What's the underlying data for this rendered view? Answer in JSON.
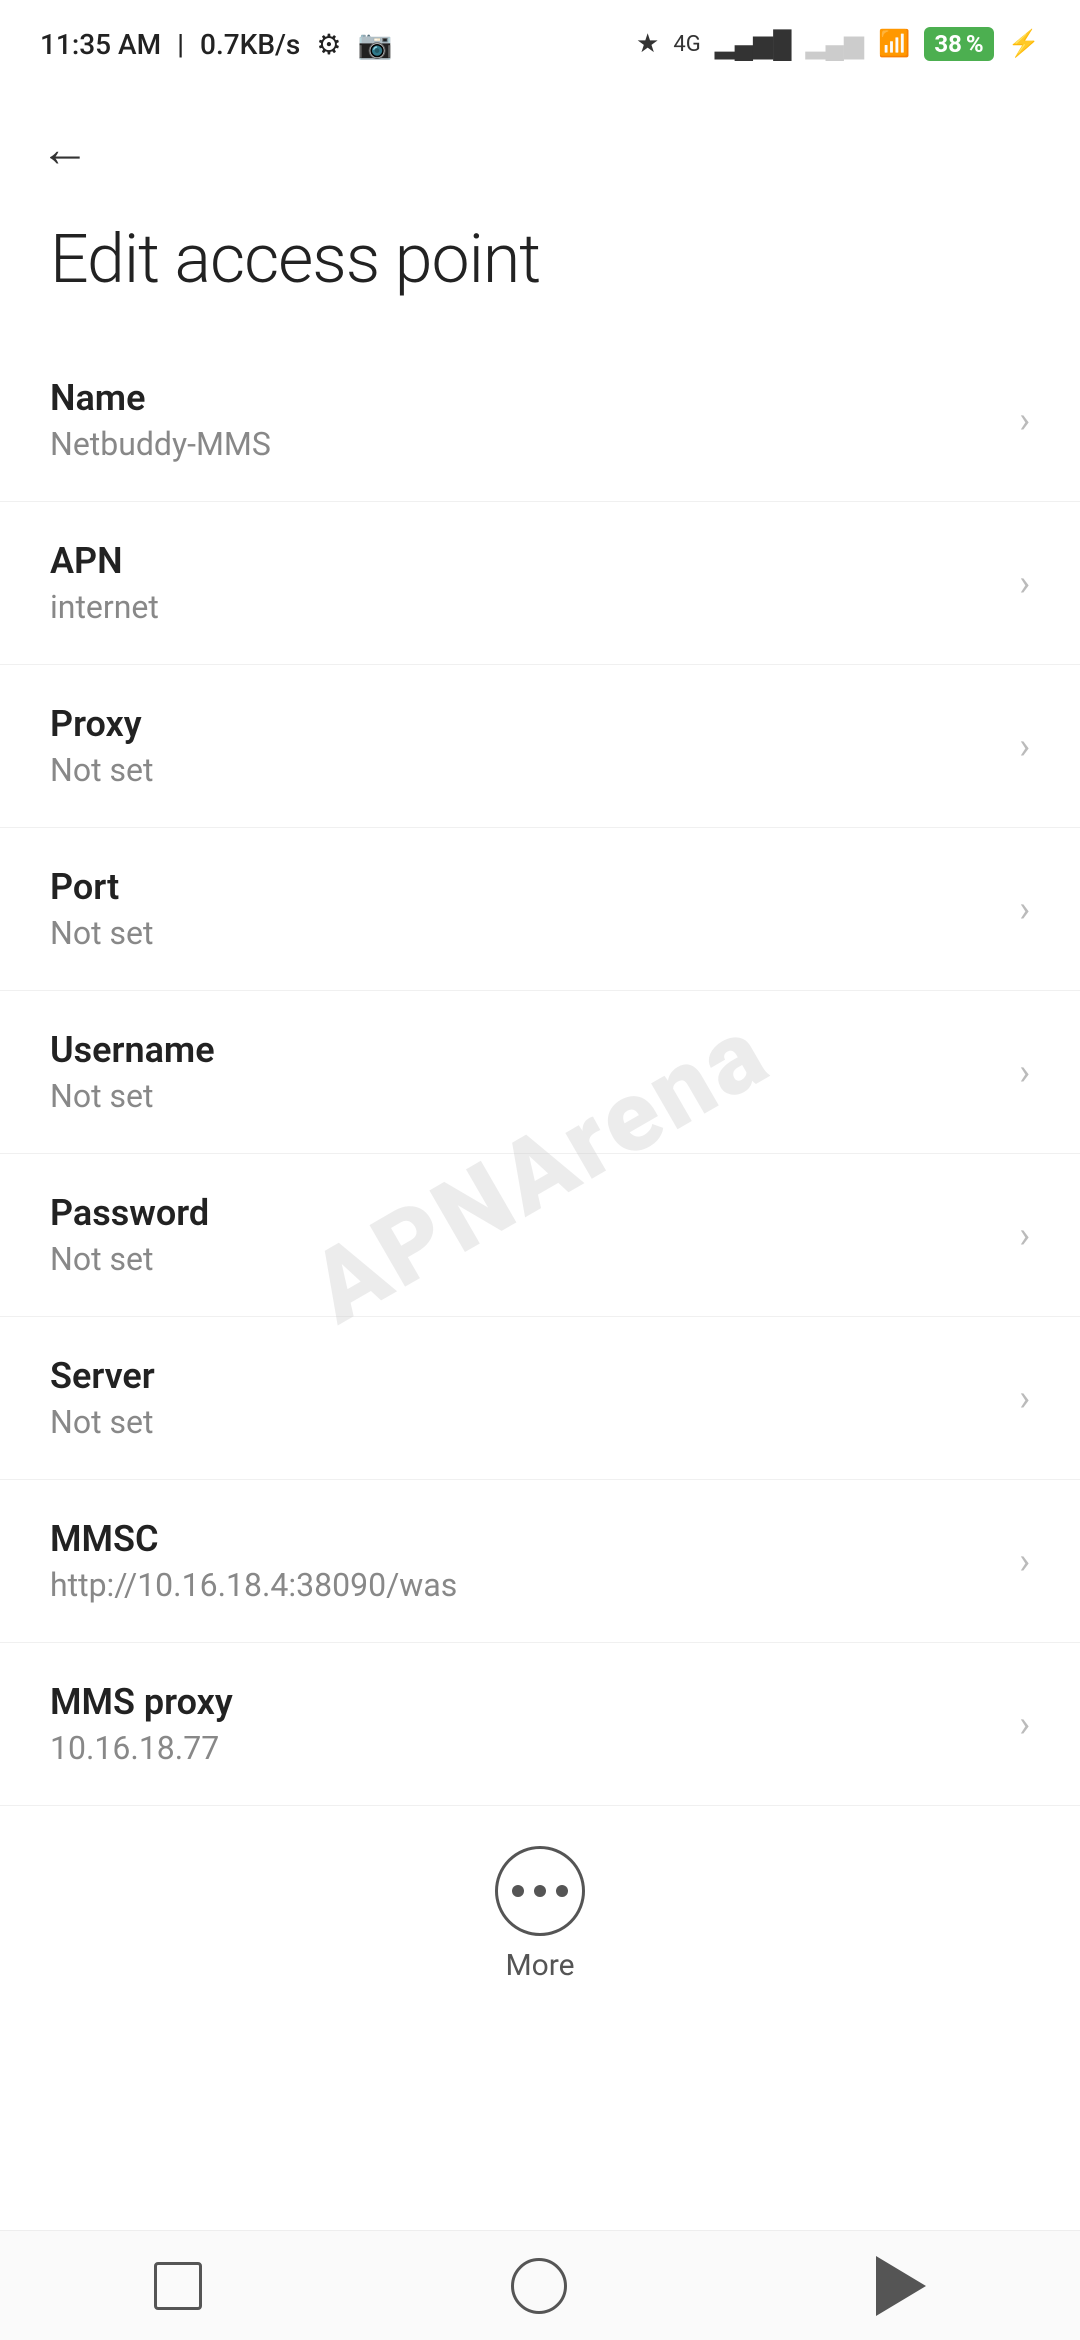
{
  "status_bar": {
    "time": "11:35 AM",
    "data_speed": "0.7KB/s",
    "battery_percent": "38"
  },
  "page": {
    "title": "Edit access point",
    "back_label": "←"
  },
  "settings_items": [
    {
      "id": "name",
      "title": "Name",
      "value": "Netbuddy-MMS"
    },
    {
      "id": "apn",
      "title": "APN",
      "value": "internet"
    },
    {
      "id": "proxy",
      "title": "Proxy",
      "value": "Not set"
    },
    {
      "id": "port",
      "title": "Port",
      "value": "Not set"
    },
    {
      "id": "username",
      "title": "Username",
      "value": "Not set"
    },
    {
      "id": "password",
      "title": "Password",
      "value": "Not set"
    },
    {
      "id": "server",
      "title": "Server",
      "value": "Not set"
    },
    {
      "id": "mmsc",
      "title": "MMSC",
      "value": "http://10.16.18.4:38090/was"
    },
    {
      "id": "mms_proxy",
      "title": "MMS proxy",
      "value": "10.16.18.77"
    }
  ],
  "more_button": {
    "label": "More"
  },
  "watermark": {
    "text": "APNArena"
  }
}
